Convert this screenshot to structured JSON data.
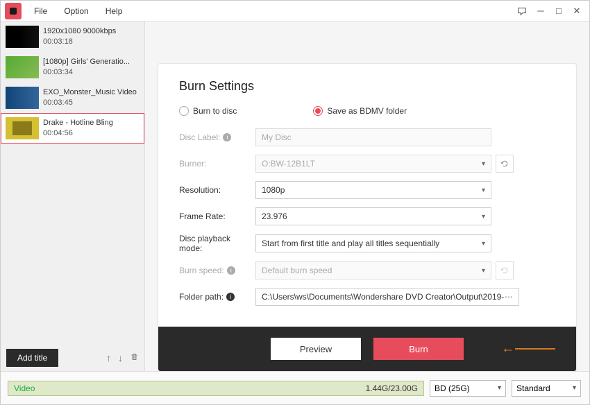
{
  "menubar": {
    "file": "File",
    "option": "Option",
    "help": "Help"
  },
  "sidebar": {
    "items": [
      {
        "title": "1920x1080 9000kbps",
        "duration": "00:03:18"
      },
      {
        "title": "[1080p] Girls' Generatio...",
        "duration": "00:03:34"
      },
      {
        "title": "EXO_Monster_Music Video",
        "duration": "00:03:45"
      },
      {
        "title": "Drake - Hotline Bling",
        "duration": "00:04:56"
      }
    ],
    "add_title": "Add title"
  },
  "panel": {
    "title": "Burn Settings",
    "radios": {
      "to_disc": "Burn to disc",
      "bdmv": "Save as BDMV folder"
    },
    "labels": {
      "disc_label": "Disc Label:",
      "burner": "Burner:",
      "resolution": "Resolution:",
      "frame_rate": "Frame Rate:",
      "playback": "Disc playback mode:",
      "burn_speed": "Burn speed:",
      "folder_path": "Folder path:"
    },
    "values": {
      "disc_label": "My Disc",
      "burner": "O:BW-12B1LT",
      "resolution": "1080p",
      "frame_rate": "23.976",
      "playback": "Start from first title and play all titles sequentially",
      "burn_speed": "Default burn speed",
      "folder_path": "C:\\Users\\ws\\Documents\\Wondershare DVD Creator\\Output\\2019-"
    },
    "buttons": {
      "preview": "Preview",
      "burn": "Burn"
    }
  },
  "statusbar": {
    "tab_label": "Video",
    "size": "1.44G/23.00G",
    "disc_type": "BD (25G)",
    "standard": "Standard"
  }
}
